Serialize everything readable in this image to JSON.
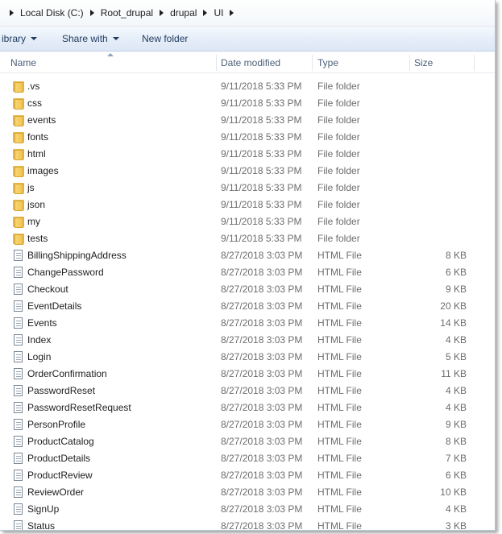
{
  "breadcrumb": [
    "Local Disk (C:)",
    "Root_drupal",
    "drupal",
    "UI"
  ],
  "toolbar": {
    "library_label": "ibrary",
    "share_label": "Share with",
    "new_folder_label": "New folder"
  },
  "columns": {
    "name": "Name",
    "date": "Date modified",
    "type": "Type",
    "size": "Size"
  },
  "files": [
    {
      "name": ".vs",
      "date": "9/11/2018 5:33 PM",
      "type": "File folder",
      "size": "",
      "icon": "folder-icon"
    },
    {
      "name": "css",
      "date": "9/11/2018 5:33 PM",
      "type": "File folder",
      "size": "",
      "icon": "folder-icon"
    },
    {
      "name": "events",
      "date": "9/11/2018 5:33 PM",
      "type": "File folder",
      "size": "",
      "icon": "folder-icon"
    },
    {
      "name": "fonts",
      "date": "9/11/2018 5:33 PM",
      "type": "File folder",
      "size": "",
      "icon": "folder-icon"
    },
    {
      "name": "html",
      "date": "9/11/2018 5:33 PM",
      "type": "File folder",
      "size": "",
      "icon": "folder-icon"
    },
    {
      "name": "images",
      "date": "9/11/2018 5:33 PM",
      "type": "File folder",
      "size": "",
      "icon": "folder-icon"
    },
    {
      "name": "js",
      "date": "9/11/2018 5:33 PM",
      "type": "File folder",
      "size": "",
      "icon": "folder-icon"
    },
    {
      "name": "json",
      "date": "9/11/2018 5:33 PM",
      "type": "File folder",
      "size": "",
      "icon": "folder-icon"
    },
    {
      "name": "my",
      "date": "9/11/2018 5:33 PM",
      "type": "File folder",
      "size": "",
      "icon": "folder-icon"
    },
    {
      "name": "tests",
      "date": "9/11/2018 5:33 PM",
      "type": "File folder",
      "size": "",
      "icon": "folder-icon"
    },
    {
      "name": "BillingShippingAddress",
      "date": "8/27/2018 3:03 PM",
      "type": "HTML File",
      "size": "8 KB",
      "icon": "html-file-icon"
    },
    {
      "name": "ChangePassword",
      "date": "8/27/2018 3:03 PM",
      "type": "HTML File",
      "size": "6 KB",
      "icon": "html-file-icon"
    },
    {
      "name": "Checkout",
      "date": "8/27/2018 3:03 PM",
      "type": "HTML File",
      "size": "9 KB",
      "icon": "html-file-icon"
    },
    {
      "name": "EventDetails",
      "date": "8/27/2018 3:03 PM",
      "type": "HTML File",
      "size": "20 KB",
      "icon": "html-file-icon"
    },
    {
      "name": "Events",
      "date": "8/27/2018 3:03 PM",
      "type": "HTML File",
      "size": "14 KB",
      "icon": "html-file-icon"
    },
    {
      "name": "Index",
      "date": "8/27/2018 3:03 PM",
      "type": "HTML File",
      "size": "4 KB",
      "icon": "html-file-icon"
    },
    {
      "name": "Login",
      "date": "8/27/2018 3:03 PM",
      "type": "HTML File",
      "size": "5 KB",
      "icon": "html-file-icon"
    },
    {
      "name": "OrderConfirmation",
      "date": "8/27/2018 3:03 PM",
      "type": "HTML File",
      "size": "11 KB",
      "icon": "html-file-icon"
    },
    {
      "name": "PasswordReset",
      "date": "8/27/2018 3:03 PM",
      "type": "HTML File",
      "size": "4 KB",
      "icon": "html-file-icon"
    },
    {
      "name": "PasswordResetRequest",
      "date": "8/27/2018 3:03 PM",
      "type": "HTML File",
      "size": "4 KB",
      "icon": "html-file-icon"
    },
    {
      "name": "PersonProfile",
      "date": "8/27/2018 3:03 PM",
      "type": "HTML File",
      "size": "9 KB",
      "icon": "html-file-icon"
    },
    {
      "name": "ProductCatalog",
      "date": "8/27/2018 3:03 PM",
      "type": "HTML File",
      "size": "8 KB",
      "icon": "html-file-icon"
    },
    {
      "name": "ProductDetails",
      "date": "8/27/2018 3:03 PM",
      "type": "HTML File",
      "size": "7 KB",
      "icon": "html-file-icon"
    },
    {
      "name": "ProductReview",
      "date": "8/27/2018 3:03 PM",
      "type": "HTML File",
      "size": "6 KB",
      "icon": "html-file-icon"
    },
    {
      "name": "ReviewOrder",
      "date": "8/27/2018 3:03 PM",
      "type": "HTML File",
      "size": "10 KB",
      "icon": "html-file-icon"
    },
    {
      "name": "SignUp",
      "date": "8/27/2018 3:03 PM",
      "type": "HTML File",
      "size": "4 KB",
      "icon": "html-file-icon"
    },
    {
      "name": "Status",
      "date": "8/27/2018 3:03 PM",
      "type": "HTML File",
      "size": "3 KB",
      "icon": "html-file-icon"
    }
  ]
}
